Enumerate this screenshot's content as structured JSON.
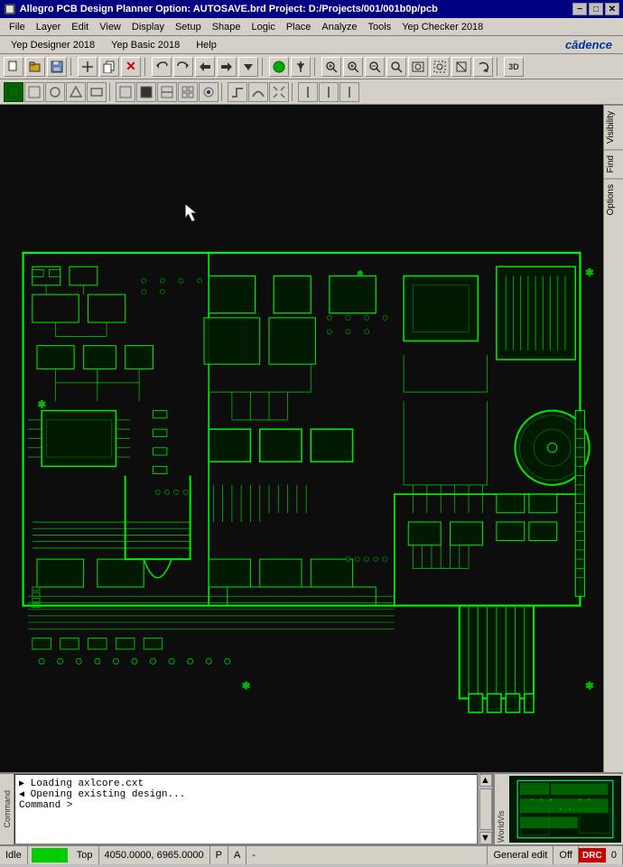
{
  "titlebar": {
    "icon": "●",
    "title": "Allegro PCB Design Planner Option: AUTOSAVE.brd  Project: D:/Projects/001/001b0p/pcb",
    "controls": [
      "−",
      "□",
      "✕"
    ]
  },
  "menubar1": {
    "items": [
      "File",
      "Layer",
      "Edit",
      "View",
      "Display",
      "Setup",
      "Shape",
      "Logic",
      "Place",
      "Analyze",
      "Tools",
      "Yep Checker 2018"
    ]
  },
  "menubar2": {
    "items": [
      "Yep Designer 2018",
      "Yep Basic 2018",
      "Help"
    ],
    "logo": "cādence"
  },
  "toolbar1": {
    "buttons": [
      "📁",
      "📂",
      "💾",
      "+",
      "📋",
      "✕",
      "↩",
      "↪",
      "⤺",
      "⤻",
      "↓",
      "●",
      "📌",
      "🔍",
      "🔍",
      "🔍",
      "🔍",
      "🔍",
      "🔍",
      "🔍",
      "🔍",
      "🔍",
      "🔍",
      "3D"
    ]
  },
  "toolbar2": {
    "buttons": [
      "■",
      "□",
      "◯",
      "△",
      "▭",
      "⬜",
      "⬛",
      "▣",
      "▤",
      "▦",
      "⊕",
      "~",
      "⌒",
      "⤢",
      "|",
      "|",
      "|"
    ]
  },
  "rightpanel": {
    "buttons": [
      "Visibility",
      "Find",
      "Options"
    ]
  },
  "console": {
    "lines": [
      "Loading axlcore.cxt",
      "Opening existing design...",
      "Command >"
    ]
  },
  "statusbar": {
    "idle": "Idle",
    "layer": "Top",
    "coords": "4050.0000, 6965.0000",
    "p": "P",
    "a": "A",
    "dash": "-",
    "mode": "General edit",
    "off": "Off",
    "drc": "DRC",
    "count": "0"
  },
  "minimap": {
    "label": "WorldVis"
  }
}
